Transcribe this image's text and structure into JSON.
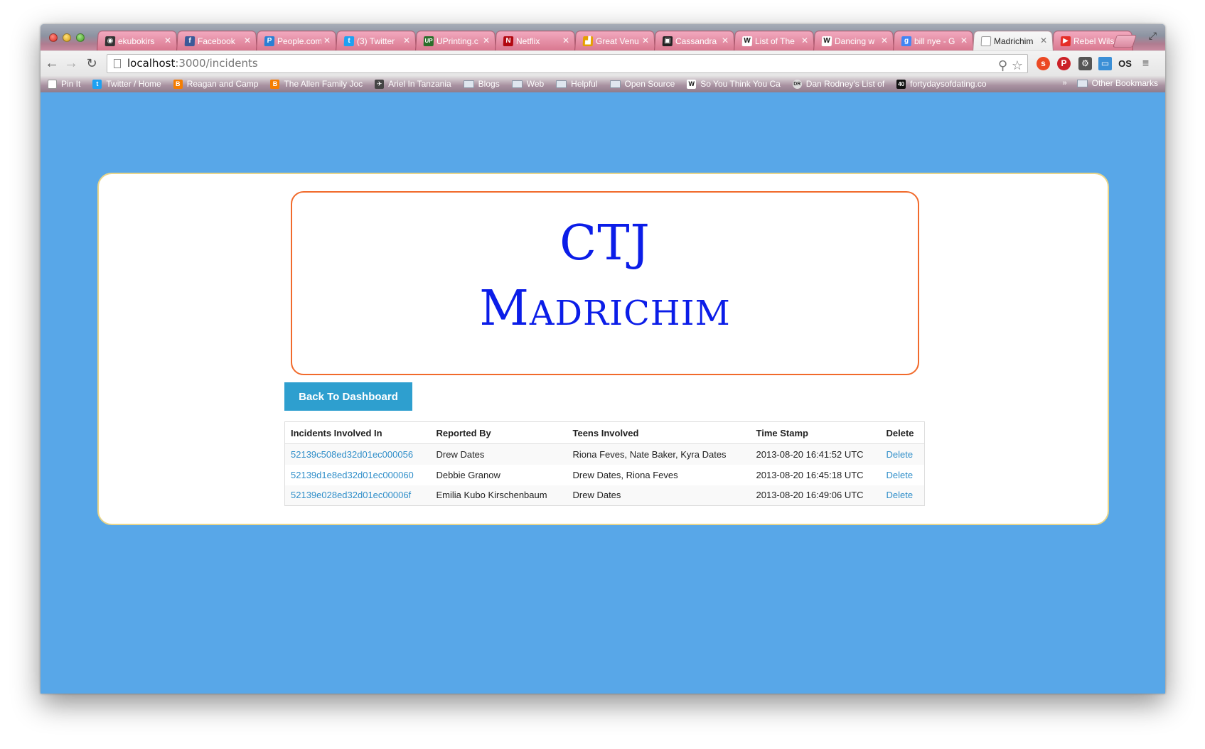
{
  "browser": {
    "tabs": [
      {
        "label": "ekubokirs",
        "icon": "github-icon",
        "color": "#333333"
      },
      {
        "label": "Facebook",
        "icon": "facebook-icon",
        "color": "#3b5998"
      },
      {
        "label": "People.com",
        "icon": "people-icon",
        "color": "#2a7fd4"
      },
      {
        "label": "(3) Twitter",
        "icon": "twitter-icon",
        "color": "#1da1f2"
      },
      {
        "label": "UPrinting.c",
        "icon": "uprinting-icon",
        "color": "#2a6e2a"
      },
      {
        "label": "Netflix",
        "icon": "netflix-icon",
        "color": "#b20710"
      },
      {
        "label": "Great Venu",
        "icon": "chart-icon",
        "color": "#e5a000"
      },
      {
        "label": "Cassandra",
        "icon": "cassandra-icon",
        "color": "#222222"
      },
      {
        "label": "List of The",
        "icon": "wikipedia-icon",
        "color": "#ffffff"
      },
      {
        "label": "Dancing w",
        "icon": "wikipedia-icon",
        "color": "#ffffff"
      },
      {
        "label": "bill nye - G",
        "icon": "google-icon",
        "color": "#4285f4"
      },
      {
        "label": "Madrichim",
        "icon": "page-icon",
        "color": "#dddddd",
        "active": true
      },
      {
        "label": "Rebel Wils",
        "icon": "youtube-icon",
        "color": "#e52d27"
      }
    ],
    "address": {
      "host": "localhost",
      "path": ":3000/incidents"
    },
    "bookmarks": [
      {
        "label": "Pin It",
        "icon": "page-icon"
      },
      {
        "label": "Twitter / Home",
        "icon": "twitter-icon"
      },
      {
        "label": "Reagan and Camp",
        "icon": "blogger-icon"
      },
      {
        "label": "The Allen Family Joc",
        "icon": "blogger-icon"
      },
      {
        "label": "Ariel In Tanzania",
        "icon": "ariel-icon"
      },
      {
        "label": "Blogs",
        "icon": "folder-icon"
      },
      {
        "label": "Web",
        "icon": "folder-icon"
      },
      {
        "label": "Helpful",
        "icon": "folder-icon"
      },
      {
        "label": "Open Source",
        "icon": "folder-icon"
      },
      {
        "label": "So You Think You Ca",
        "icon": "wikipedia-icon"
      },
      {
        "label": "Dan Rodney's List of",
        "icon": "dr-icon"
      },
      {
        "label": "fortydaysofdating.co",
        "icon": "forty-icon"
      }
    ],
    "other_bookmarks": "Other Bookmarks",
    "more_chevron": "»"
  },
  "page": {
    "banner": {
      "line1": "CTJ",
      "line2": "Madrichim"
    },
    "back_button": "Back To Dashboard",
    "table": {
      "headers": [
        "Incidents Involved In",
        "Reported By",
        "Teens Involved",
        "Time Stamp",
        "Delete"
      ],
      "rows": [
        {
          "id": "52139c508ed32d01ec000056",
          "reported_by": "Drew Dates",
          "teens": "Riona Feves, Nate Baker, Kyra Dates",
          "time": "2013-08-20 16:41:52 UTC",
          "delete": "Delete"
        },
        {
          "id": "52139d1e8ed32d01ec000060",
          "reported_by": "Debbie Granow",
          "teens": "Drew Dates, Riona Feves",
          "time": "2013-08-20 16:45:18 UTC",
          "delete": "Delete"
        },
        {
          "id": "52139e028ed32d01ec00006f",
          "reported_by": "Emilia Kubo Kirschenbaum",
          "teens": "Drew Dates",
          "time": "2013-08-20 16:49:06 UTC",
          "delete": "Delete"
        }
      ]
    }
  },
  "colors": {
    "page_background": "#58a7e8",
    "banner_border": "#f16a2b",
    "banner_text": "#0b1de8",
    "button": "#2e9fcf",
    "link": "#2f8ec9",
    "panel_border": "#e8d58a"
  }
}
